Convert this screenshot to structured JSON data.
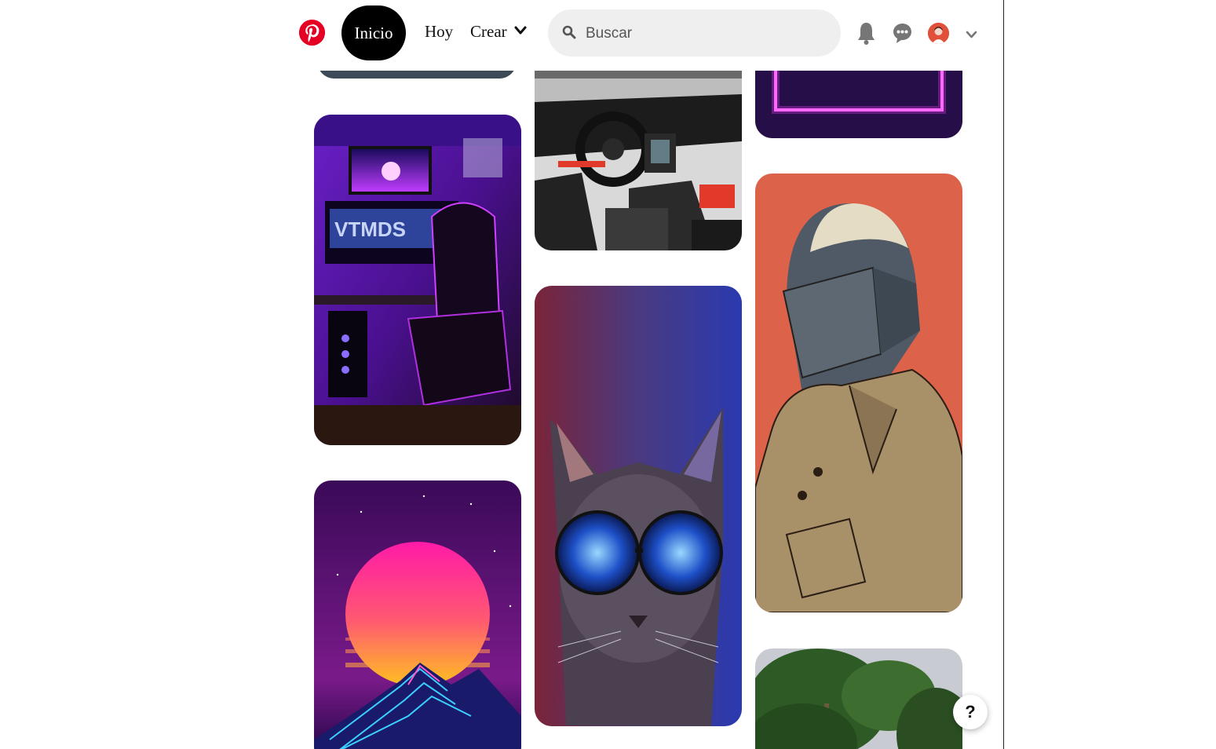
{
  "header": {
    "logo_icon": "pinterest-logo-icon",
    "nav": {
      "home_label": "Inicio",
      "today_label": "Hoy",
      "create_label": "Crear"
    },
    "search": {
      "placeholder": "Buscar",
      "value": ""
    },
    "icons": [
      "bell-icon",
      "chat-icon",
      "avatar",
      "chevron-down-icon"
    ]
  },
  "help_button": {
    "label": "?"
  },
  "pins": [
    {
      "name": "pin-top-partial-col1",
      "subject": "partial image"
    },
    {
      "name": "pin-gaming-setup",
      "subject": "purple neon gaming setup"
    },
    {
      "name": "pin-synthwave-sunset",
      "subject": "synthwave sun over mountains"
    },
    {
      "name": "pin-car-interior",
      "subject": "sports car interior"
    },
    {
      "name": "pin-cat-sunglasses",
      "subject": "cat with galaxy sunglasses"
    },
    {
      "name": "pin-neon-frame",
      "subject": "neon frame"
    },
    {
      "name": "pin-helmet-character",
      "subject": "illustrated helmet character"
    },
    {
      "name": "pin-trees",
      "subject": "trees and sky"
    }
  ],
  "colors": {
    "brand": "#e60023",
    "nav_active_bg": "#000000",
    "search_bg": "#efefef"
  }
}
